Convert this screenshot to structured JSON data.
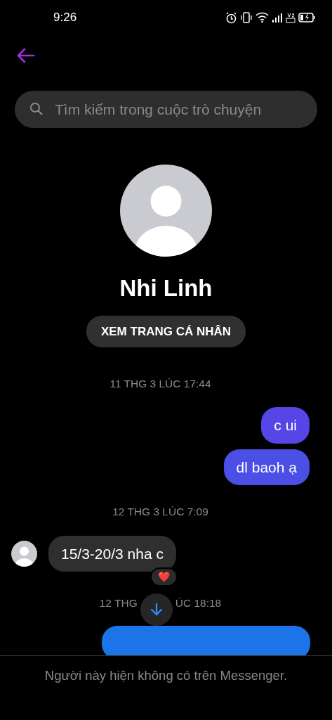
{
  "status_bar": {
    "time": "9:26"
  },
  "search": {
    "placeholder": "Tìm kiếm trong cuộc trò chuyện"
  },
  "profile": {
    "name": "Nhi Linh",
    "button": "XEM TRANG CÁ NHÂN"
  },
  "thread": [
    {
      "kind": "timestamp",
      "text": "11 THG 3 LÚC 17:44"
    },
    {
      "kind": "message",
      "outgoing": true,
      "text": "c ui",
      "color": "#5646e8"
    },
    {
      "kind": "message",
      "outgoing": true,
      "text": "dl baoh ạ",
      "color": "#4b4fe6"
    },
    {
      "kind": "timestamp",
      "text": "12 THG 3 LÚC 7:09"
    },
    {
      "kind": "message",
      "outgoing": false,
      "text": "15/3-20/3 nha c",
      "reaction": "❤️"
    },
    {
      "kind": "split_timestamp",
      "left": "12 THG",
      "right": "ÚC 18:18"
    },
    {
      "kind": "message",
      "outgoing": true,
      "color": "#1b74e8"
    }
  ],
  "footer": {
    "text": "Người này hiện không có trên Messenger."
  }
}
